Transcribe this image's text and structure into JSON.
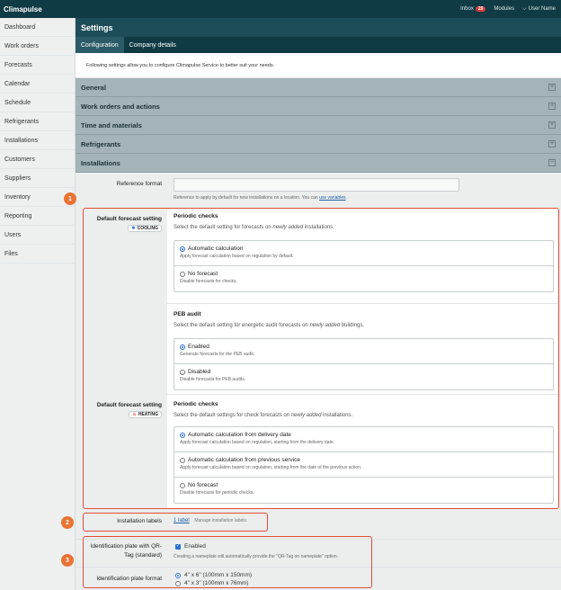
{
  "app": {
    "logo": "Climapulse"
  },
  "topbar": {
    "inbox_label": "Inbox",
    "inbox_count": "29",
    "modules": "Modules",
    "user": "User Name"
  },
  "sidebar": {
    "items": [
      "Dashboard",
      "Work orders",
      "Forecasts",
      "Calendar",
      "Schedule",
      "Refrigerants",
      "Installations",
      "Customers",
      "Suppliers",
      "Inventory",
      "Reporting",
      "Users",
      "Files"
    ]
  },
  "page": {
    "title": "Settings",
    "tabs": [
      "Configuration",
      "Company details"
    ],
    "intro": "Following settings allow you to configure Climapulse Service to better suit your needs."
  },
  "sections": [
    "General",
    "Work orders and actions",
    "Time and materials",
    "Refrigerants",
    "Installations"
  ],
  "reference": {
    "label": "Reference format",
    "help": "Reference to apply by default for new installations on a location. You can",
    "help_link": "use variables",
    "help_end": "."
  },
  "cooling": {
    "label": "Default forecast setting",
    "tag": "COOLING",
    "periodic": {
      "title": "Periodic checks",
      "sub_a": "Select the default setting for forecasts on",
      "sub_em": "newly added",
      "sub_b": "installations.",
      "options": [
        {
          "title": "Automatic calculation",
          "desc": "Apply forecast calculation based on regulation by default."
        },
        {
          "title": "No forecast",
          "desc": "Disable forecasts for checks."
        }
      ]
    },
    "peb": {
      "title": "PEB audit",
      "sub_a": "Select the default setting for energetic audit forecasts on",
      "sub_em": "newly added",
      "sub_b": "buildings.",
      "options": [
        {
          "title": "Enabled",
          "desc": "Generate forecasts for the PEB audit."
        },
        {
          "title": "Disabled",
          "desc": "Disable forecasts for PEB audits."
        }
      ]
    }
  },
  "heating": {
    "label": "Default forecast setting",
    "tag": "HEATING",
    "periodic": {
      "title": "Periodic checks",
      "sub_a": "Select the default settings for check forecasts on",
      "sub_em": "newly added",
      "sub_b": "installations.",
      "options": [
        {
          "title": "Automatic calculation from delivery date",
          "desc": "Apply forecast calculation based on regulation, starting from the delivery date."
        },
        {
          "title": "Automatic calculation from previous service",
          "desc": "Apply forecast calculation based on regulation, starting from the date of the previous action."
        },
        {
          "title": "No forecast",
          "desc": "Disable forecasts for periodic checks."
        }
      ]
    }
  },
  "labels_row": {
    "label": "Installation labels",
    "link": "1 label",
    "hint": "Manage installation labels."
  },
  "qr": {
    "label_line1": "Identification plate with QR-",
    "label_line2": "Tag (standard)",
    "check": "Enabled",
    "desc": "Creating a nameplate will automatically provide the \"QR-Tag on nameplate\" option."
  },
  "plate_format": {
    "label": "Identification plate format",
    "options": [
      "4\" x 6\" (100mm x 150mm)",
      "4\" x 3\" (100mm x 76mm)"
    ]
  },
  "markers": [
    "1",
    "2",
    "3"
  ],
  "colors": {
    "topbar": "#0f3b45",
    "accent_red": "#e24b3a",
    "marker": "#e97332",
    "badge": "#e03b3b"
  }
}
